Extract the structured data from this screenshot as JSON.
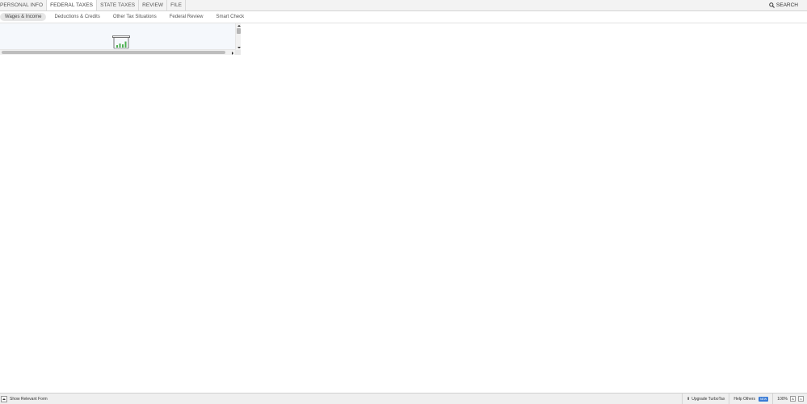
{
  "top_nav": {
    "tabs": [
      {
        "label": "PERSONAL INFO",
        "active": false
      },
      {
        "label": "FEDERAL TAXES",
        "active": true
      },
      {
        "label": "STATE TAXES",
        "active": false
      },
      {
        "label": "REVIEW",
        "active": false
      },
      {
        "label": "FILE",
        "active": false
      }
    ],
    "search_label": "SEARCH",
    "search_icon": "magnifier-icon"
  },
  "sub_nav": {
    "tabs": [
      {
        "label": "Wages & Income",
        "active": true
      },
      {
        "label": "Deductions & Credits",
        "active": false
      },
      {
        "label": "Other Tax Situations",
        "active": false
      },
      {
        "label": "Federal Review",
        "active": false
      },
      {
        "label": "Smart Check",
        "active": false
      }
    ]
  },
  "content": {
    "loading_icon": "presentation-chart-icon"
  },
  "status_bar": {
    "show_form_label": "Show Relevant Form",
    "upgrade_label": "Upgrade TurboTax",
    "help_label": "Help Others",
    "help_badge": "NEW",
    "zoom_value": "100%",
    "zoom_large_label": "A",
    "zoom_small_label": "A"
  },
  "colors": {
    "chart_bars": "#4caf50",
    "panel_bg": "#f5f8fc",
    "badge": "#3a7bd5"
  }
}
